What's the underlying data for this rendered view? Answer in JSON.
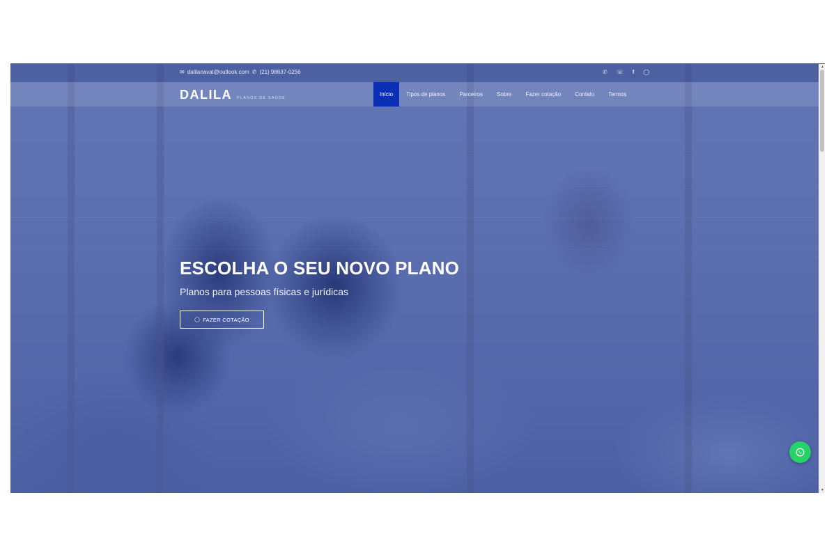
{
  "topbar": {
    "email": "dalilanaval@outlook.com",
    "phone": "(21) 98637-0256",
    "icons": [
      "mail-icon",
      "phone-icon",
      "whatsapp-icon",
      "phone-icon",
      "facebook-icon",
      "instagram-icon"
    ]
  },
  "brand": {
    "name": "DALILA",
    "tagline": "PLANOS DE SAÚDE"
  },
  "nav": {
    "items": [
      {
        "label": "Início",
        "active": true
      },
      {
        "label": "Tipos de planos"
      },
      {
        "label": "Parceiros"
      },
      {
        "label": "Sobre"
      },
      {
        "label": "Fazer cotação"
      },
      {
        "label": "Contato"
      },
      {
        "label": "Termos"
      }
    ]
  },
  "hero": {
    "title": "ESCOLHA O SEU NOVO PLANO",
    "subtitle": "Planos para pessoas físicas e jurídicas",
    "cta_label": "FAZER COTAÇÃO"
  },
  "colors": {
    "overlay": "#223e96",
    "nav_active": "#0c2fb8",
    "whatsapp": "#25d366"
  }
}
